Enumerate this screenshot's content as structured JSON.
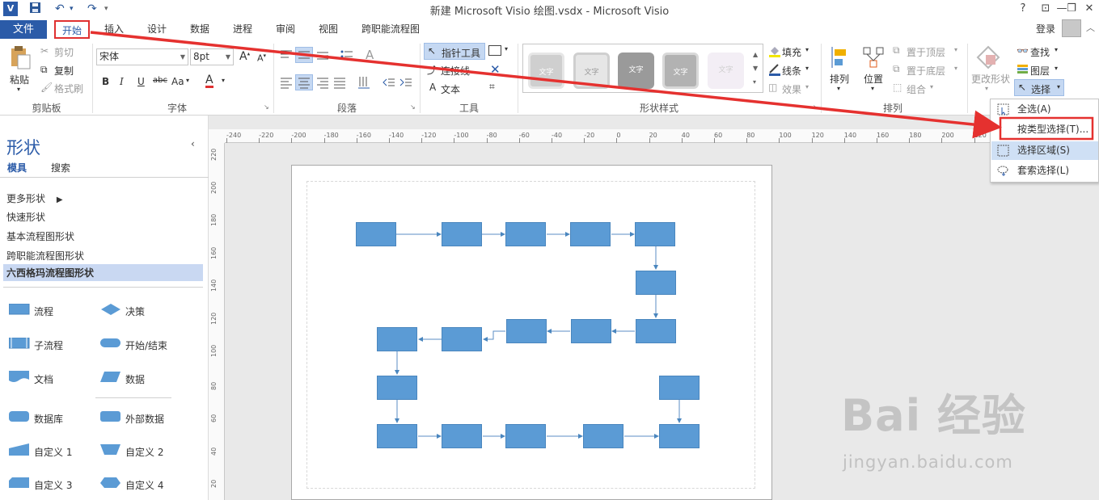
{
  "app_title": "新建 Microsoft Visio 绘图.vsdx - Microsoft Visio",
  "window_controls": {
    "help": "?",
    "restore_ribbon": "⊡",
    "minimize": "—",
    "restore": "❐",
    "close": "✕"
  },
  "tabs": {
    "file": "文件",
    "items": [
      "开始",
      "插入",
      "设计",
      "数据",
      "进程",
      "审阅",
      "视图",
      "跨职能流程图"
    ],
    "active": "开始"
  },
  "account": {
    "login": "登录"
  },
  "ribbon": {
    "clipboard": {
      "label": "剪贴板",
      "paste": "粘贴",
      "cut": "剪切",
      "copy": "复制",
      "format_painter": "格式刷"
    },
    "font": {
      "label": "字体",
      "family": "宋体",
      "size": "8pt",
      "bold": "B",
      "italic": "I",
      "underline": "U",
      "strike": "abc",
      "case": "Aa",
      "color": "A"
    },
    "paragraph": {
      "label": "段落"
    },
    "tools": {
      "label": "工具",
      "pointer": "指针工具",
      "connector": "连接线",
      "text": "文本"
    },
    "shape_styles": {
      "label": "形状样式",
      "tile_text": "文字",
      "fill": "填充",
      "line": "线条",
      "effect": "效果"
    },
    "arrange": {
      "label": "排列",
      "align": "排列",
      "position": "位置",
      "bring_front": "置于顶层",
      "send_back": "置于底层",
      "group": "组合"
    },
    "editing": {
      "change_shape": "更改形状",
      "find": "查找",
      "layers": "图层",
      "select": "选择"
    }
  },
  "shapes_panel": {
    "title": "形状",
    "tabs": [
      "模具",
      "搜索"
    ],
    "stencils": [
      "更多形状",
      "快速形状",
      "基本流程图形状",
      "跨职能流程图形状",
      "六西格玛流程图形状"
    ],
    "active_stencil": "六西格玛流程图形状",
    "items": [
      {
        "label": "流程",
        "icon": "process-icon"
      },
      {
        "label": "决策",
        "icon": "decision-icon"
      },
      {
        "label": "子流程",
        "icon": "subprocess-icon"
      },
      {
        "label": "开始/结束",
        "icon": "terminator-icon"
      },
      {
        "label": "文档",
        "icon": "document-icon"
      },
      {
        "label": "数据",
        "icon": "data-icon"
      },
      {
        "label": "数据库",
        "icon": "database-icon"
      },
      {
        "label": "外部数据",
        "icon": "external-data-icon"
      },
      {
        "label": "自定义 1",
        "icon": "custom1-icon"
      },
      {
        "label": "自定义 2",
        "icon": "custom2-icon"
      },
      {
        "label": "自定义 3",
        "icon": "custom3-icon"
      },
      {
        "label": "自定义 4",
        "icon": "custom4-icon"
      }
    ]
  },
  "ruler": {
    "h_ticks": [
      "-240",
      "-220",
      "-200",
      "-180",
      "-160",
      "-140",
      "-120",
      "-100",
      "-80",
      "-60",
      "-40",
      "-20",
      "0",
      "20",
      "40",
      "60",
      "80",
      "100",
      "120",
      "140",
      "160",
      "180",
      "200",
      "220"
    ],
    "v_ticks": [
      "220",
      "200",
      "180",
      "160",
      "140",
      "120",
      "100",
      "80",
      "60",
      "40",
      "20"
    ]
  },
  "select_menu": {
    "items": [
      {
        "label": "全选(A)",
        "icon": "select-all-icon"
      },
      {
        "label": "按类型选择(T)...",
        "icon": "select-by-type-icon"
      },
      {
        "label": "选择区域(S)",
        "icon": "area-select-icon"
      },
      {
        "label": "套索选择(L)",
        "icon": "lasso-select-icon"
      }
    ],
    "highlighted": "选择区域(S)",
    "annotated": "按类型选择(T)..."
  },
  "annotation": {
    "color": "#e5312f"
  },
  "watermark": {
    "text": "Bai 经验",
    "url": "jingyan.baidu.com"
  },
  "colors": {
    "accent": "#2b5ba8",
    "shape_fill": "#5b9bd5",
    "highlight": "#cfe0f5",
    "annotation": "#e5312f"
  }
}
